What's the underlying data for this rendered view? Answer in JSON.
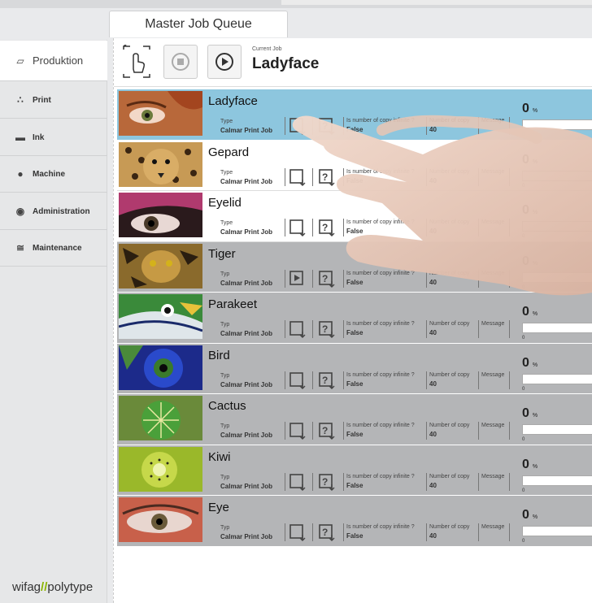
{
  "tab": {
    "label": "Master Job Queue"
  },
  "sidebar": {
    "items": [
      {
        "label": "Produktion",
        "icon": "production-icon"
      },
      {
        "label": "Print",
        "icon": "print-icon"
      },
      {
        "label": "Ink",
        "icon": "ink-icon"
      },
      {
        "label": "Machine",
        "icon": "machine-icon"
      },
      {
        "label": "Administration",
        "icon": "administration-icon"
      },
      {
        "label": "Maintenance",
        "icon": "maintenance-icon"
      }
    ],
    "brand_left": "wifag",
    "brand_sep": "//",
    "brand_right": "polytype"
  },
  "toolbar": {
    "current_label": "Current Job",
    "current_name": "Ladyface"
  },
  "colors": {
    "selected": "#8dc6de",
    "accent": "#5aa9cf",
    "brand_green": "#8ab400"
  },
  "jobs": [
    {
      "name": "Ladyface",
      "type_label": "Type",
      "type": "Calmar Print Job",
      "infinite_label": "Is number of copy infinite ?",
      "infinite": "False",
      "copies_label": "Number of copy",
      "copies": "40",
      "message_label": "Message",
      "progress": "0",
      "progress_unit": "%",
      "progress_min": "0"
    },
    {
      "name": "Gepard",
      "type_label": "Type",
      "type": "Calmar Print Job",
      "infinite_label": "Is number of copy infinite ?",
      "infinite": "False",
      "copies_label": "Number of copy",
      "copies": "40",
      "message_label": "Message",
      "progress": "0",
      "progress_unit": "%",
      "progress_min": "0"
    },
    {
      "name": "Eyelid",
      "type_label": "Type",
      "type": "Calmar Print Job",
      "infinite_label": "Is number of copy infinite ?",
      "infinite": "False",
      "copies_label": "Number of copy",
      "copies": "40",
      "message_label": "Message",
      "progress": "0",
      "progress_unit": "%",
      "progress_min": "0"
    },
    {
      "name": "Tiger",
      "type_label": "Typ",
      "type": "Calmar Print Job",
      "infinite_label": "Is number of copy infinite ?",
      "infinite": "False",
      "copies_label": "Number of copy",
      "copies": "40",
      "message_label": "Message",
      "progress": "0",
      "progress_unit": "%",
      "progress_min": "0"
    },
    {
      "name": "Parakeet",
      "type_label": "Typ",
      "type": "Calmar Print Job",
      "infinite_label": "Is number of copy infinite ?",
      "infinite": "False",
      "copies_label": "Number of copy",
      "copies": "40",
      "message_label": "Message",
      "progress": "0",
      "progress_unit": "%",
      "progress_min": "0"
    },
    {
      "name": "Bird",
      "type_label": "Typ",
      "type": "Calmar Print Job",
      "infinite_label": "Is number of copy infinite ?",
      "infinite": "False",
      "copies_label": "Number of copy",
      "copies": "40",
      "message_label": "Message",
      "progress": "0",
      "progress_unit": "%",
      "progress_min": "0"
    },
    {
      "name": "Cactus",
      "type_label": "Typ",
      "type": "Calmar Print Job",
      "infinite_label": "Is number of copy infinite ?",
      "infinite": "False",
      "copies_label": "Number of copy",
      "copies": "40",
      "message_label": "Message",
      "progress": "0",
      "progress_unit": "%",
      "progress_min": "0"
    },
    {
      "name": "Kiwi",
      "type_label": "Typ",
      "type": "Calmar Print Job",
      "infinite_label": "Is number of copy infinite ?",
      "infinite": "False",
      "copies_label": "Number of copy",
      "copies": "40",
      "message_label": "Message",
      "progress": "0",
      "progress_unit": "%",
      "progress_min": "0"
    },
    {
      "name": "Eye",
      "type_label": "Typ",
      "type": "Calmar Print Job",
      "infinite_label": "Is number of copy infinite ?",
      "infinite": "False",
      "copies_label": "Number of copy",
      "copies": "40",
      "message_label": "Message",
      "progress": "0",
      "progress_unit": "%",
      "progress_min": "0"
    }
  ]
}
